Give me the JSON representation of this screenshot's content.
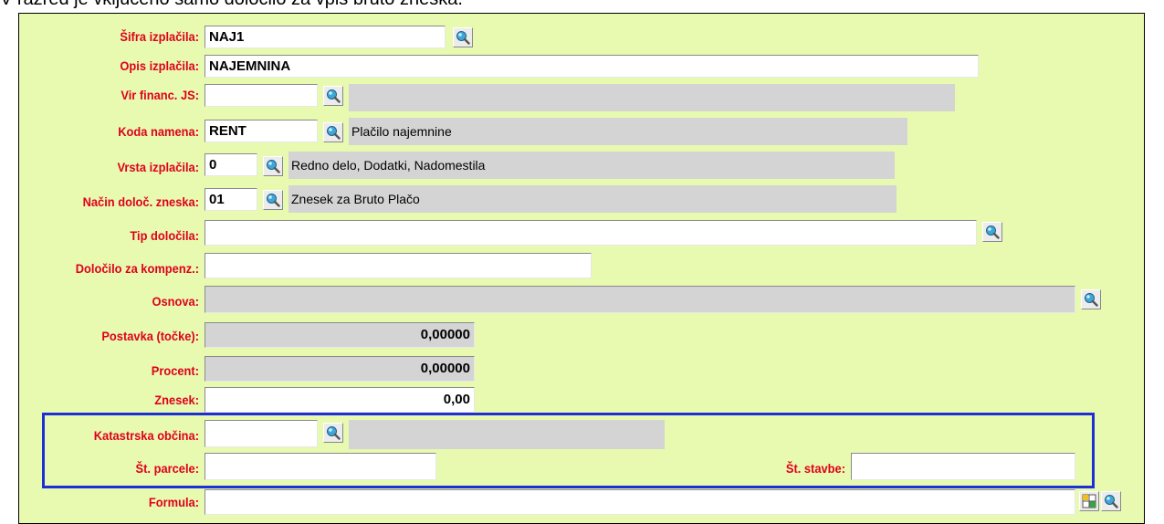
{
  "caption": "V razred je vključeno samo določilo za vpis bruto zneska.",
  "form": {
    "sifra_label": "Šifra izplačila:",
    "sifra_value": "NAJ1",
    "opis_label": "Opis izplačila:",
    "opis_value": "NAJEMNINA",
    "vir_label": "Vir financ. JS:",
    "vir_value": "",
    "vir_desc": "",
    "koda_label": "Koda namena:",
    "koda_value": "RENT",
    "koda_desc": "Plačilo najemnine",
    "vrsta_label": "Vrsta izplačila:",
    "vrsta_value": "0",
    "vrsta_desc": "Redno delo, Dodatki, Nadomestila",
    "nacin_label": "Način določ. zneska:",
    "nacin_value": "01",
    "nacin_desc": "Znesek za Bruto Plačo",
    "tip_label": "Tip določila:",
    "tip_value": "",
    "dolocilo_label": "Določilo za kompenz.:",
    "dolocilo_value": "",
    "osnova_label": "Osnova:",
    "osnova_value": "",
    "postavka_label": "Postavka (točke):",
    "postavka_value": "0,00000",
    "procent_label": "Procent:",
    "procent_value": "0,00000",
    "znesek_label": "Znesek:",
    "znesek_value": "0,00",
    "katastrska_label": "Katastrska občina:",
    "katastrska_value": "",
    "katastrska_desc": "",
    "parcela_label": "Št. parcele:",
    "parcela_value": "",
    "stavba_label": "Št. stavbe:",
    "stavba_value": "",
    "formula_label": "Formula:",
    "formula_value": ""
  },
  "icons": {
    "lookup": "magnifier-icon",
    "editor": "table-grid-icon"
  },
  "colors": {
    "panel_bg": "#e8f9b0",
    "label_red": "#e0001b",
    "highlight_blue": "#1f2fd6",
    "readonly_grey": "#d4d4d4"
  }
}
